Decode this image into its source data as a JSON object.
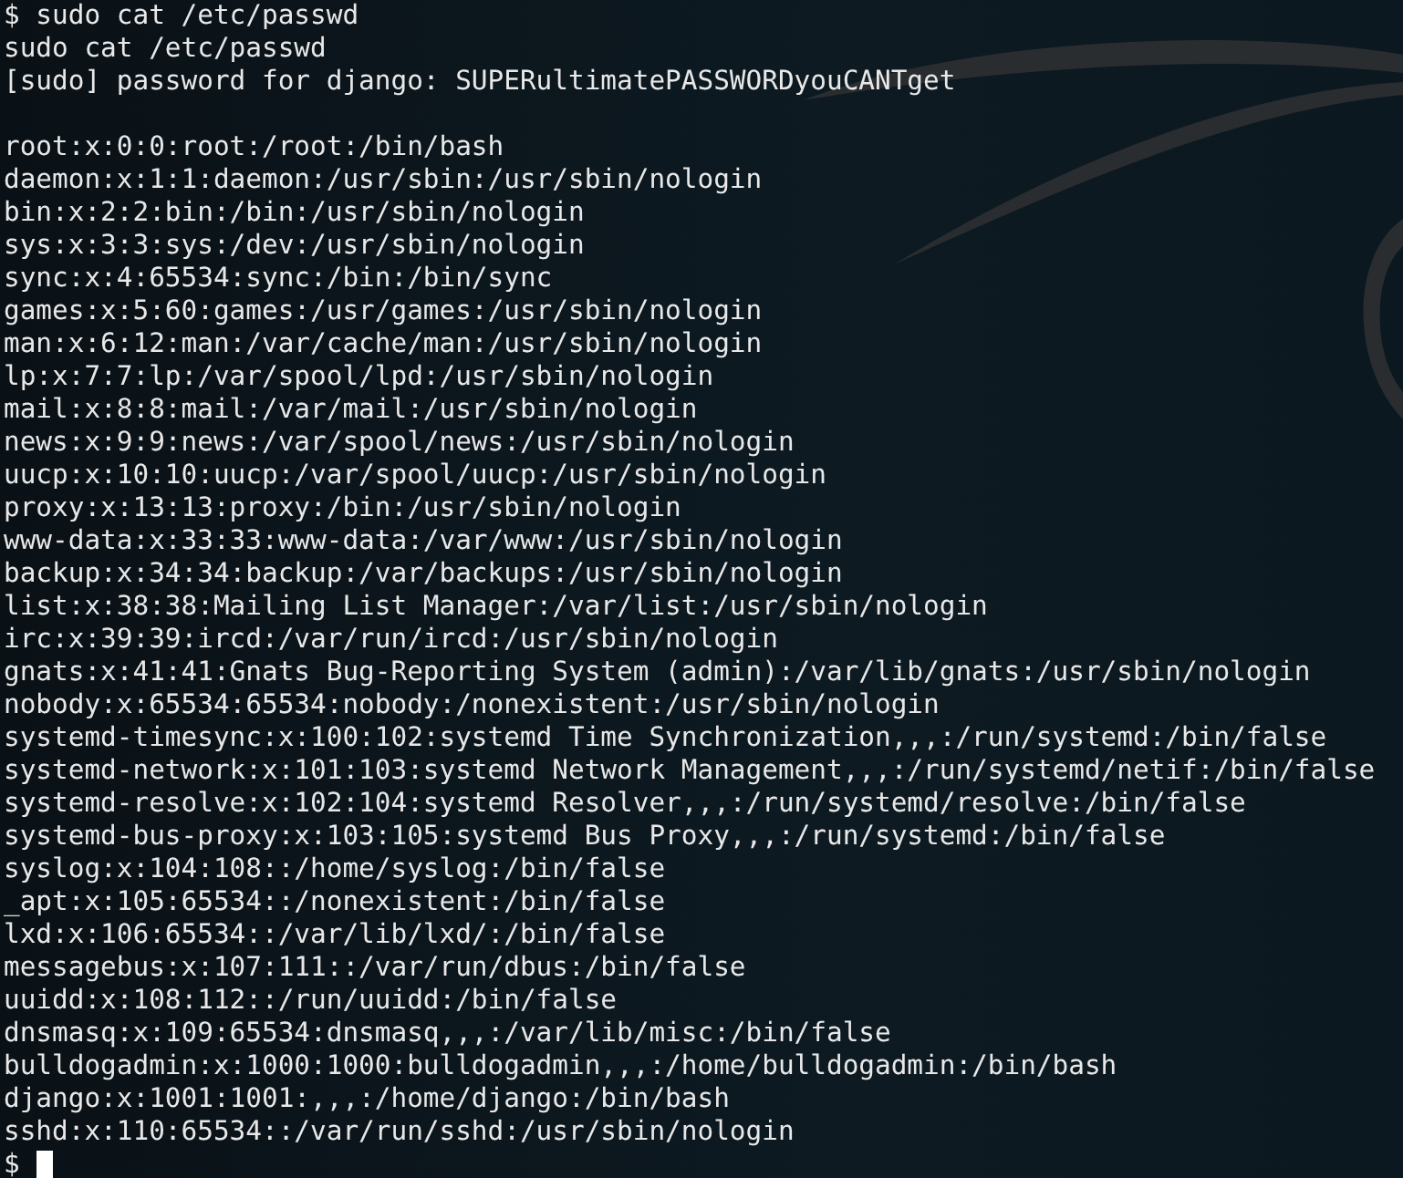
{
  "terminal": {
    "lines": [
      {
        "kind": "text",
        "text": "$ sudo cat /etc/passwd"
      },
      {
        "kind": "text",
        "text": "sudo cat /etc/passwd"
      },
      {
        "kind": "text",
        "text": "[sudo] password for django: SUPERultimatePASSWORDyouCANTget"
      },
      {
        "kind": "blank"
      },
      {
        "kind": "text",
        "text": "root:x:0:0:root:/root:/bin/bash"
      },
      {
        "kind": "text",
        "text": "daemon:x:1:1:daemon:/usr/sbin:/usr/sbin/nologin"
      },
      {
        "kind": "text",
        "text": "bin:x:2:2:bin:/bin:/usr/sbin/nologin"
      },
      {
        "kind": "text",
        "text": "sys:x:3:3:sys:/dev:/usr/sbin/nologin"
      },
      {
        "kind": "text",
        "text": "sync:x:4:65534:sync:/bin:/bin/sync"
      },
      {
        "kind": "text",
        "text": "games:x:5:60:games:/usr/games:/usr/sbin/nologin"
      },
      {
        "kind": "text",
        "text": "man:x:6:12:man:/var/cache/man:/usr/sbin/nologin"
      },
      {
        "kind": "text",
        "text": "lp:x:7:7:lp:/var/spool/lpd:/usr/sbin/nologin"
      },
      {
        "kind": "text",
        "text": "mail:x:8:8:mail:/var/mail:/usr/sbin/nologin"
      },
      {
        "kind": "text",
        "text": "news:x:9:9:news:/var/spool/news:/usr/sbin/nologin"
      },
      {
        "kind": "text",
        "text": "uucp:x:10:10:uucp:/var/spool/uucp:/usr/sbin/nologin"
      },
      {
        "kind": "text",
        "text": "proxy:x:13:13:proxy:/bin:/usr/sbin/nologin"
      },
      {
        "kind": "text",
        "text": "www-data:x:33:33:www-data:/var/www:/usr/sbin/nologin"
      },
      {
        "kind": "text",
        "text": "backup:x:34:34:backup:/var/backups:/usr/sbin/nologin"
      },
      {
        "kind": "text",
        "text": "list:x:38:38:Mailing List Manager:/var/list:/usr/sbin/nologin"
      },
      {
        "kind": "text",
        "text": "irc:x:39:39:ircd:/var/run/ircd:/usr/sbin/nologin"
      },
      {
        "kind": "text",
        "text": "gnats:x:41:41:Gnats Bug-Reporting System (admin):/var/lib/gnats:/usr/sbin/nologin"
      },
      {
        "kind": "text",
        "text": "nobody:x:65534:65534:nobody:/nonexistent:/usr/sbin/nologin"
      },
      {
        "kind": "text",
        "text": "systemd-timesync:x:100:102:systemd Time Synchronization,,,:/run/systemd:/bin/false"
      },
      {
        "kind": "text",
        "text": "systemd-network:x:101:103:systemd Network Management,,,:/run/systemd/netif:/bin/false"
      },
      {
        "kind": "text",
        "text": "systemd-resolve:x:102:104:systemd Resolver,,,:/run/systemd/resolve:/bin/false"
      },
      {
        "kind": "text",
        "text": "systemd-bus-proxy:x:103:105:systemd Bus Proxy,,,:/run/systemd:/bin/false"
      },
      {
        "kind": "text",
        "text": "syslog:x:104:108::/home/syslog:/bin/false"
      },
      {
        "kind": "text",
        "text": "_apt:x:105:65534::/nonexistent:/bin/false"
      },
      {
        "kind": "text",
        "text": "lxd:x:106:65534::/var/lib/lxd/:/bin/false"
      },
      {
        "kind": "text",
        "text": "messagebus:x:107:111::/var/run/dbus:/bin/false"
      },
      {
        "kind": "text",
        "text": "uuidd:x:108:112::/run/uuidd:/bin/false"
      },
      {
        "kind": "text",
        "text": "dnsmasq:x:109:65534:dnsmasq,,,:/var/lib/misc:/bin/false"
      },
      {
        "kind": "text",
        "text": "bulldogadmin:x:1000:1000:bulldogadmin,,,:/home/bulldogadmin:/bin/bash"
      },
      {
        "kind": "text",
        "text": "django:x:1001:1001:,,,:/home/django:/bin/bash"
      },
      {
        "kind": "text",
        "text": "sshd:x:110:65534::/var/run/sshd:/usr/sbin/nologin"
      }
    ],
    "prompt": {
      "symbol": "$",
      "cursor": true
    }
  }
}
